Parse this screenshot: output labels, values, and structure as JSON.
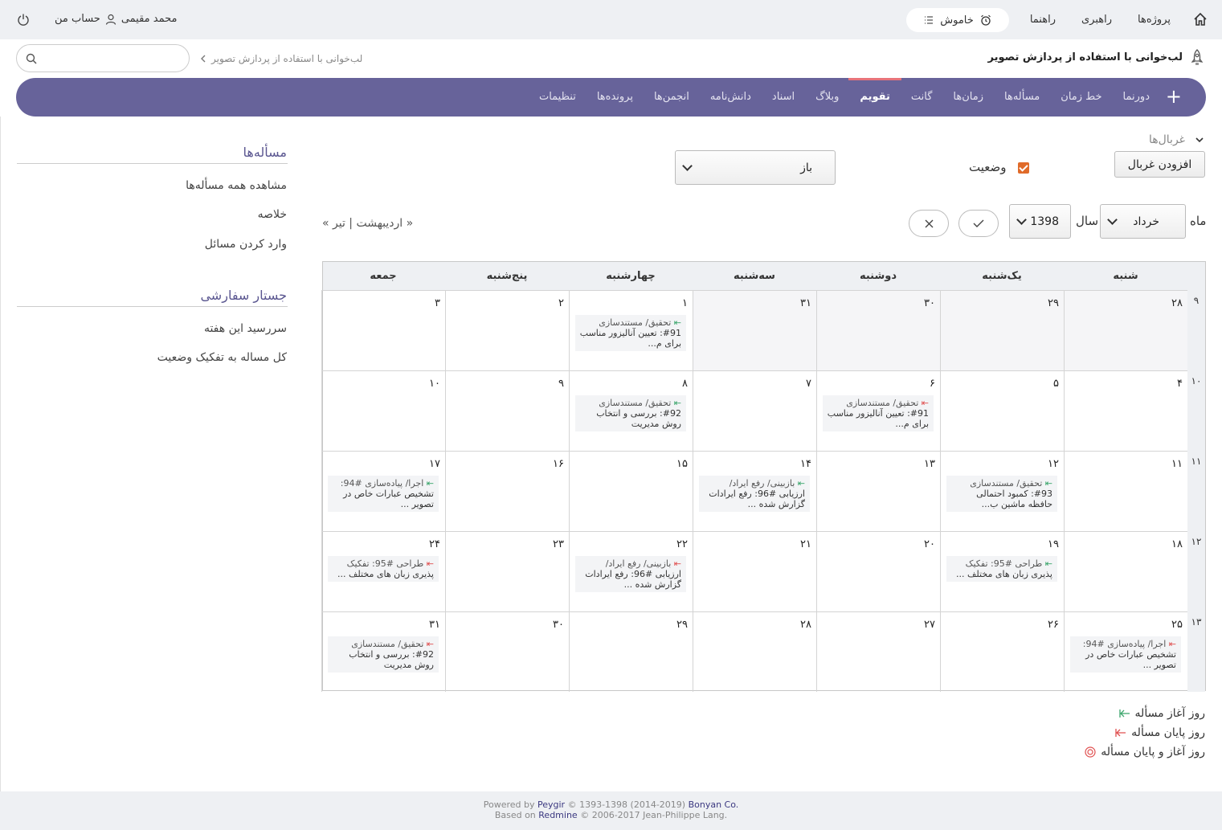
{
  "topbar": {
    "nav": [
      "پروژه‌ها",
      "راهبری",
      "راهنما"
    ],
    "timer_label": "خاموش",
    "user_name": "محمد مقیمی",
    "account_label": "حساب من"
  },
  "header": {
    "project_title": "لب‌خوانی با استفاده از پردازش تصویر",
    "breadcrumb": "لب‌خوانی با استفاده از پردازش تصویر",
    "search_placeholder": ""
  },
  "mainnav": {
    "tabs": [
      "دورنما",
      "خط زمان",
      "مسأله‌ها",
      "زمان‌ها",
      "گانت",
      "تقویم",
      "وبلاگ",
      "اسناد",
      "دانش‌نامه",
      "انجمن‌ها",
      "پرونده‌ها",
      "تنظیمات"
    ],
    "selected": "تقویم",
    "plus": "+"
  },
  "sidebar": {
    "issues_title": "مسأله‌ها",
    "issues_links": [
      "مشاهده همه مسأله‌ها",
      "خلاصه",
      "وارد کردن مسائل"
    ],
    "custom_title": "جستار سفارشی",
    "custom_links": [
      "سررسید این هفته",
      "کل مساله به تفکیک وضعیت"
    ]
  },
  "filters": {
    "label": "غربال‌ها",
    "add_button": "افزودن غربال",
    "status_label": "وضعیت",
    "status_value": "باز",
    "status_checked": true
  },
  "period": {
    "month_label": "ماه",
    "month_value": "خرداد",
    "year_label": "سال",
    "year_value": "1398",
    "apply_icon": "check-icon",
    "clear_icon": "close-icon",
    "month_nav": "« اردیبهشت | تیر »"
  },
  "calendar": {
    "days": [
      "شنبه",
      "یک‌شنبه",
      "دوشنبه",
      "سه‌شنبه",
      "چهارشنبه",
      "پنج‌شنبه",
      "جمعه"
    ],
    "weeks": [
      {
        "week": "۹",
        "dates": [
          "۲۸",
          "۲۹",
          "۳۰",
          "۳۱",
          "۱",
          "۲",
          "۳"
        ],
        "other_month": [
          true,
          true,
          true,
          true,
          false,
          false,
          false
        ]
      },
      {
        "week": "۱۰",
        "dates": [
          "۴",
          "۵",
          "۶",
          "۷",
          "۸",
          "۹",
          "۱۰"
        ],
        "other_month": [
          false,
          false,
          false,
          false,
          false,
          false,
          false
        ]
      },
      {
        "week": "۱۱",
        "dates": [
          "۱۱",
          "۱۲",
          "۱۳",
          "۱۴",
          "۱۵",
          "۱۶",
          "۱۷"
        ],
        "other_month": [
          false,
          false,
          false,
          false,
          false,
          false,
          false
        ]
      },
      {
        "week": "۱۲",
        "dates": [
          "۱۸",
          "۱۹",
          "۲۰",
          "۲۱",
          "۲۲",
          "۲۳",
          "۲۴"
        ],
        "other_month": [
          false,
          false,
          false,
          false,
          false,
          false,
          false
        ]
      },
      {
        "week": "۱۳",
        "dates": [
          "۲۵",
          "۲۶",
          "۲۷",
          "۲۸",
          "۲۹",
          "۳۰",
          "۳۱"
        ],
        "other_month": [
          false,
          false,
          false,
          false,
          false,
          false,
          false
        ]
      }
    ],
    "events": [
      {
        "week": 0,
        "day": 4,
        "kind": "start",
        "tracker": "تحقیق/ مستندسازی",
        "text": "#91: تعیین آنالیزور مناسب برای م..."
      },
      {
        "week": 1,
        "day": 2,
        "kind": "end",
        "tracker": "تحقیق/ مستندسازی",
        "text": "#91: تعیین آنالیزور مناسب برای م..."
      },
      {
        "week": 1,
        "day": 4,
        "kind": "start",
        "tracker": "تحقیق/ مستندسازی",
        "text": "#92: بررسی و انتخاب روش مدیریت"
      },
      {
        "week": 2,
        "day": 1,
        "kind": "start",
        "tracker": "تحقیق/ مستندسازی",
        "text": "#93: کمبود احتمالی حافظه ماشین ب..."
      },
      {
        "week": 2,
        "day": 3,
        "kind": "start",
        "tracker": "بازبینی/ رفع ایراد/",
        "text": "ارزیابی #96: رفع ایرادات گزارش شده ..."
      },
      {
        "week": 2,
        "day": 6,
        "kind": "start",
        "tracker": "اجرا/ پیاده‌سازی #94:",
        "text": "تشخیص عبارات خاص در تصویر ..."
      },
      {
        "week": 3,
        "day": 1,
        "kind": "start",
        "tracker": "طراحی #95: تفکیک",
        "text": "پذیری زبان های مختلف ..."
      },
      {
        "week": 3,
        "day": 4,
        "kind": "end",
        "tracker": "بازبینی/ رفع ایراد/",
        "text": "ارزیابی #96: رفع ایرادات گزارش شده ..."
      },
      {
        "week": 3,
        "day": 6,
        "kind": "end",
        "tracker": "طراحی #95: تفکیک",
        "text": "پذیری زبان های مختلف ..."
      },
      {
        "week": 4,
        "day": 0,
        "kind": "end",
        "tracker": "اجرا/ پیاده‌سازی #94:",
        "text": "تشخیص عبارات خاص در تصویر ..."
      },
      {
        "week": 4,
        "day": 6,
        "kind": "end",
        "tracker": "تحقیق/ مستندسازی",
        "text": "#92: بررسی و انتخاب روش مدیریت"
      }
    ]
  },
  "legend": {
    "start": "روز آغاز مسأله",
    "end": "روز پایان مسأله",
    "both": "روز آغاز و پایان مسأله"
  },
  "footer": {
    "line1_a": "Powered by ",
    "line1_link": "Peygir",
    "line1_b": " © 1393-1398 (2014-2019) ",
    "line1_c": "Bonyan Co.",
    "line2_a": "Based on ",
    "line2_link": "Redmine",
    "line2_b": " © 2006-2017 Jean-Philippe Lang."
  },
  "colors": {
    "nav_purple": "#67639a",
    "accent_red": "#e8737a",
    "start_green": "#3aa56b",
    "end_red": "#e05050",
    "checkbox_orange": "#e06b2a"
  }
}
